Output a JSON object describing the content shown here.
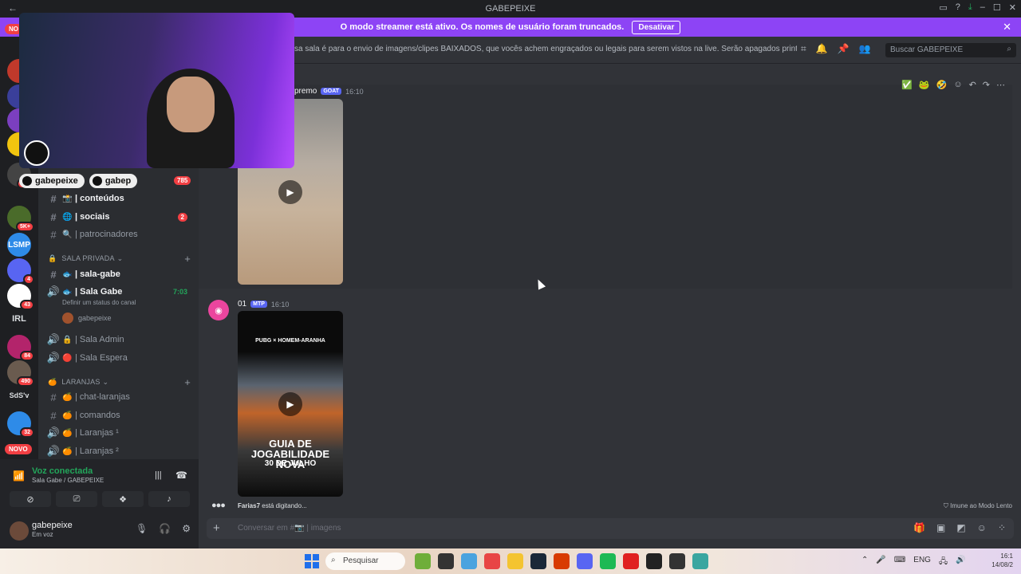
{
  "window": {
    "title": "GABEPEIXE"
  },
  "streamer_banner": {
    "message": "O modo streamer está ativo. Os nomes de usuário foram truncados.",
    "button_label": "Desativar"
  },
  "servers": [
    {
      "label": "",
      "badge": ""
    },
    {
      "label": "",
      "badge": "1"
    },
    {
      "label": "",
      "badge": "2"
    },
    {
      "label": "",
      "badge": ""
    },
    {
      "label": "",
      "badge": "363"
    },
    {
      "label": "",
      "badge": "5K+"
    },
    {
      "label": "",
      "badge": "4"
    },
    {
      "label": "",
      "badge": "43"
    },
    {
      "label": "IRL",
      "badge": ""
    },
    {
      "label": "",
      "badge": "84"
    },
    {
      "label": "",
      "badge": "490"
    },
    {
      "label": "SdS'v",
      "badge": ""
    },
    {
      "label": "",
      "badge": "32"
    }
  ],
  "server_labels": {
    "novo_top": "NO",
    "novo_bottom": "NOVO"
  },
  "overlay": {
    "tag1": "gabepeixe",
    "tag2": "gabep",
    "count": "785"
  },
  "channels": {
    "items": [
      {
        "label": "| conteúdos",
        "emoji": "📸",
        "count": "",
        "active": true
      },
      {
        "label": "| sociais",
        "emoji": "🌐",
        "count": "2",
        "active": true
      },
      {
        "label": "| patrocinadores",
        "emoji": "🔍",
        "count": "",
        "active": false
      }
    ],
    "cat_private": "SALA PRIVADA",
    "private_items": [
      {
        "label": "| sala-gabe",
        "emoji": "🐟",
        "active": true
      },
      {
        "label": "| Sala Gabe",
        "emoji": "🐟",
        "active": true,
        "time": "7:03",
        "status": "Definir um status do canal"
      },
      {
        "label": "gabepeixe",
        "emoji": "",
        "active": false
      },
      {
        "label": "| Sala Admin",
        "emoji": "🔒",
        "active": false
      },
      {
        "label": "| Sala Espera",
        "emoji": "🔴",
        "active": false
      }
    ],
    "cat_laranjas": "LARANJAS",
    "laranjas_items": [
      {
        "label": "| chat-laranjas",
        "emoji": "🍊"
      },
      {
        "label": "| comandos",
        "emoji": "🍊"
      },
      {
        "label": "| Laranjas ¹",
        "emoji": "🍊"
      },
      {
        "label": "| Laranjas ²",
        "emoji": "🍊"
      }
    ]
  },
  "voice": {
    "title": "Voz conectada",
    "subtitle": "Sala Gabe / GABEPEIXE"
  },
  "user": {
    "name": "gabepeixe",
    "status": "Em voz"
  },
  "header": {
    "topic": "sa sala é para o envio de imagens/clipes BAIXADOS, que vocês achem engraçados ou legais para serem vistos na live. Serão apagados prints de outras rede...",
    "search_placeholder": "Buscar GABEPEIXE"
  },
  "messages": [
    {
      "name": "premo",
      "tag": "GOAT",
      "time": "16:10"
    },
    {
      "name": "01",
      "tag": "MTP",
      "time": "16:10",
      "video_text_1": "PUBG × HOMEM-ARANHA",
      "video_text_2": "GUIA DE JOGABILIDADE NOVA",
      "video_text_3": "30 DE JULHO"
    }
  ],
  "typing": {
    "user": "Farias7",
    "text": " está digitando..."
  },
  "slow_mode": "Imune ao Modo Lento",
  "composer": {
    "placeholder": "Conversar em #📷 | imagens"
  },
  "taskbar": {
    "search": "Pesquisar",
    "lang": "ENG",
    "time": "16:1",
    "date": "14/08/2"
  },
  "colors": {
    "accent": "#8d44f5",
    "brand": "#5865f2",
    "danger": "#f23f43",
    "online": "#23a55a"
  }
}
